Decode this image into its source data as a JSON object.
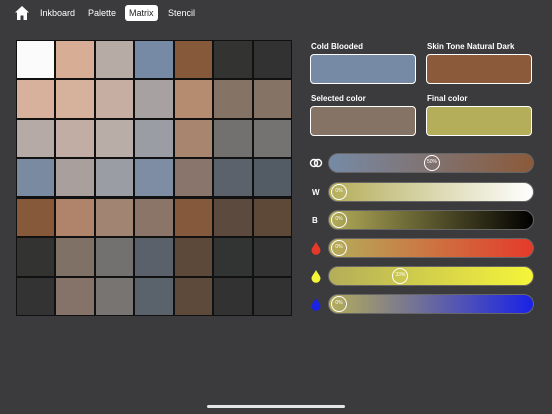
{
  "nav": {
    "tabs": [
      {
        "label": "Inkboard"
      },
      {
        "label": "Palette"
      },
      {
        "label": "Matrix"
      },
      {
        "label": "Stencil"
      }
    ],
    "active_tab": "Matrix"
  },
  "matrix": {
    "rows": [
      [
        "#fbfbfb",
        "#d7ad96",
        "#b7aba5",
        "#768aa6",
        "#87593b",
        "#333332",
        "#323233"
      ],
      [
        "#d7b19c",
        "#d6b19c",
        "#c7aea2",
        "#a8a1a1",
        "#b68c70",
        "#857366",
        "#857366"
      ],
      [
        "#b5aaa5",
        "#c1ada3",
        "#b9aea7",
        "#9a9ea4",
        "#a8856f",
        "#737170",
        "#747371"
      ],
      [
        "#7a8aa1",
        "#a9a09d",
        "#9a9ea4",
        "#7e8da4",
        "#8a756c",
        "#5b626b",
        "#535b65"
      ],
      [
        "#87593b",
        "#af846b",
        "#a18471",
        "#8b7569",
        "#85593b",
        "#5d4a3f",
        "#5e4838"
      ],
      [
        "#333332",
        "#807167",
        "#737170",
        "#5a616a",
        "#5d4939",
        "#323333",
        "#323232"
      ],
      [
        "#333333",
        "#85736a",
        "#777472",
        "#5a626c",
        "#5d4a3a",
        "#323232",
        "#323233"
      ]
    ]
  },
  "swatches": {
    "cold_blooded": {
      "label": "Cold Blooded",
      "color": "#768aa6"
    },
    "skin_tone": {
      "label": "Skin Tone Natural Dark",
      "color": "#8b5a3a"
    },
    "selected": {
      "label": "Selected color",
      "color": "#857366"
    },
    "final": {
      "label": "Final color",
      "color": "#b4ad5a"
    }
  },
  "sliders": [
    {
      "icon": "blend-icon",
      "letter": "",
      "value": "50%",
      "fraction": 0.5,
      "gradient": [
        "#768aa6",
        "#8b5a3a"
      ]
    },
    {
      "icon": "",
      "letter": "W",
      "value": "0%",
      "fraction": 0.0,
      "gradient": [
        "#b4ad5a",
        "#ffffff"
      ]
    },
    {
      "icon": "",
      "letter": "B",
      "value": "0%",
      "fraction": 0.0,
      "gradient": [
        "#b4ad5a",
        "#000000"
      ]
    },
    {
      "icon": "drop-red-icon",
      "letter": "",
      "value": "0%",
      "fraction": 0.0,
      "gradient": [
        "#b4ad5a",
        "#e53a2a"
      ],
      "icon_color": "#e53a2a"
    },
    {
      "icon": "drop-yellow-icon",
      "letter": "",
      "value": "33%",
      "fraction": 0.33,
      "gradient": [
        "#b4ad5a",
        "#f5f53a"
      ],
      "icon_color": "#f5f53a"
    },
    {
      "icon": "drop-blue-icon",
      "letter": "",
      "value": "0%",
      "fraction": 0.0,
      "gradient": [
        "#b4ad5a",
        "#1a22e6"
      ],
      "icon_color": "#1a22e6"
    }
  ]
}
